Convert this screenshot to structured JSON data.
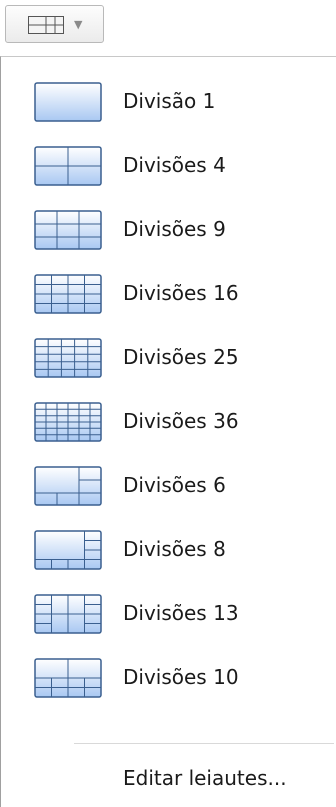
{
  "toolbar": {
    "layout_icon": "grid-layout-icon",
    "arrow": "▼"
  },
  "menu": {
    "items": [
      {
        "label": "Divisão 1",
        "grid": "1x1"
      },
      {
        "label": "Divisões 4",
        "grid": "2x2"
      },
      {
        "label": "Divisões 9",
        "grid": "3x3"
      },
      {
        "label": "Divisões 16",
        "grid": "4x4"
      },
      {
        "label": "Divisões 25",
        "grid": "5x5"
      },
      {
        "label": "Divisões 36",
        "grid": "6x6"
      },
      {
        "label": "Divisões 6",
        "grid": "1-large-plus-5"
      },
      {
        "label": "Divisões 8",
        "grid": "1-large-plus-7"
      },
      {
        "label": "Divisões 13",
        "grid": "mixed-13"
      },
      {
        "label": "Divisões 10",
        "grid": "mixed-10"
      }
    ],
    "edit_label": "Editar leiautes..."
  },
  "colors": {
    "thumb_top": "#ffffff",
    "thumb_bottom": "#a9c8f2",
    "thumb_border": "#3a5f8f"
  }
}
